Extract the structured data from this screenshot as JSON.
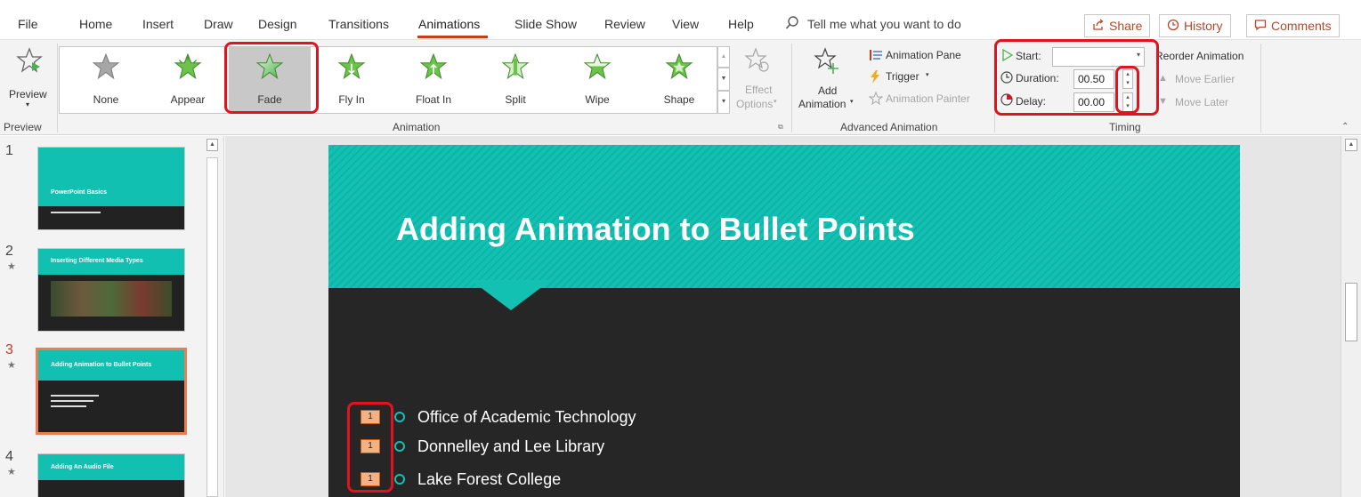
{
  "tabs": [
    "File",
    "Home",
    "Insert",
    "Draw",
    "Design",
    "Transitions",
    "Animations",
    "Slide Show",
    "Review",
    "View",
    "Help"
  ],
  "active_tab": "Animations",
  "tell_me": "Tell me what you want to do",
  "top_buttons": {
    "share": "Share",
    "history": "History",
    "comments": "Comments"
  },
  "ribbon": {
    "preview": {
      "button": "Preview",
      "group": "Preview"
    },
    "animation": {
      "group": "Animation",
      "gallery": [
        {
          "label": "None",
          "icon": "star-none-icon",
          "color": "#9a9a9a"
        },
        {
          "label": "Appear",
          "icon": "star-appear-icon",
          "color": "#4caf50"
        },
        {
          "label": "Fade",
          "icon": "star-fade-icon",
          "color": "#4caf50",
          "selected": true
        },
        {
          "label": "Fly In",
          "icon": "star-flyin-icon",
          "color": "#4caf50"
        },
        {
          "label": "Float In",
          "icon": "star-floatin-icon",
          "color": "#4caf50"
        },
        {
          "label": "Split",
          "icon": "star-split-icon",
          "color": "#4caf50"
        },
        {
          "label": "Wipe",
          "icon": "star-wipe-icon",
          "color": "#4caf50"
        },
        {
          "label": "Shape",
          "icon": "star-shape-icon",
          "color": "#4caf50"
        }
      ],
      "effect_options_line1": "Effect",
      "effect_options_line2": "Options"
    },
    "advanced": {
      "group": "Advanced Animation",
      "add_line1": "Add",
      "add_line2": "Animation",
      "animation_pane": "Animation Pane",
      "trigger": "Trigger",
      "animation_painter": "Animation Painter"
    },
    "timing": {
      "group": "Timing",
      "start_label": "Start:",
      "start_value": "",
      "duration_label": "Duration:",
      "duration_value": "00.50",
      "delay_label": "Delay:",
      "delay_value": "00.00",
      "reorder": "Reorder Animation",
      "move_earlier": "Move Earlier",
      "move_later": "Move Later"
    }
  },
  "slides": [
    {
      "num": "1",
      "title": "PowerPoint Basics",
      "star": false
    },
    {
      "num": "2",
      "title": "Inserting Different Media Types",
      "star": true
    },
    {
      "num": "3",
      "title": "Adding Animation to Bullet Points",
      "star": true
    },
    {
      "num": "4",
      "title": "Adding An Audio File",
      "star": true
    }
  ],
  "current_slide": {
    "title": "Adding Animation to Bullet Points",
    "bullets": [
      {
        "tag": "1",
        "text": "Office of Academic Technology"
      },
      {
        "tag": "1",
        "text": "Donnelley and Lee Library"
      },
      {
        "tag": "1",
        "text": "Lake Forest College"
      }
    ]
  },
  "colors": {
    "accent": "#c43e1c",
    "teal": "#12c1b2",
    "highlight": "#e0131f",
    "tag": "#f4b183"
  }
}
